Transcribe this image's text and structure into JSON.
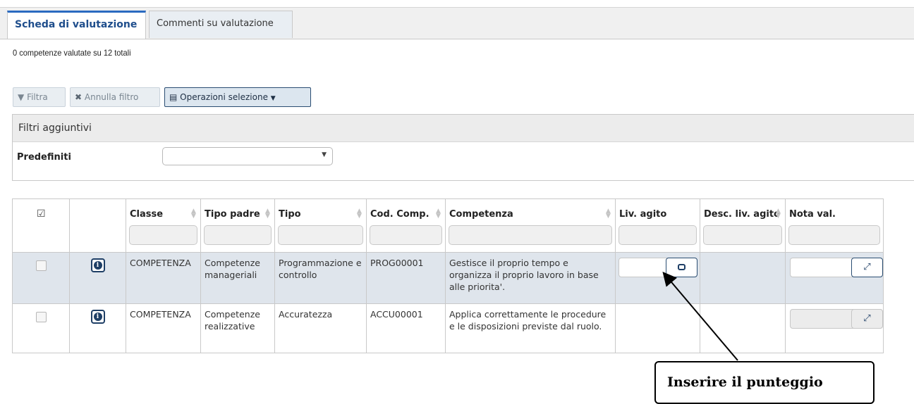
{
  "tabs": [
    {
      "label": "Scheda di valutazione",
      "active": true
    },
    {
      "label": "Commenti su valutazione",
      "active": false
    }
  ],
  "summary": "0 competenze valutate su 12 totali",
  "toolbar": {
    "filter_label": "Filtra",
    "clear_filter_label": "Annulla filtro",
    "operations_label": "Operazioni selezione"
  },
  "filters_panel": {
    "title": "Filtri aggiuntivi",
    "predefined_label": "Predefiniti",
    "predefined_value": ""
  },
  "table": {
    "columns": [
      "Classe",
      "Tipo padre",
      "Tipo",
      "Cod. Comp.",
      "Competenza",
      "Liv. agito",
      "Desc. liv. agito",
      "Nota val."
    ],
    "rows": [
      {
        "classe": "COMPETENZA",
        "tipo_padre": "Competenze manageriali",
        "tipo": "Programmazione e controllo",
        "cod_comp": "PROG00001",
        "competenza": "Gestisce il proprio tempo e organizza il proprio lavoro in base alle priorita'.",
        "liv_agito": "",
        "desc_liv_agito": "",
        "nota_val": ""
      },
      {
        "classe": "COMPETENZA",
        "tipo_padre": "Competenze realizzative",
        "tipo": "Accuratezza",
        "cod_comp": "ACCU00001",
        "competenza": "Applica correttamente le procedure e le disposizioni previste dal ruolo.",
        "liv_agito": "",
        "desc_liv_agito": "",
        "nota_val": ""
      }
    ]
  },
  "annotation": {
    "text": "Inserire il punteggio"
  },
  "icons": {
    "filter": "filter-icon",
    "clear": "x-icon",
    "operations": "clipboard-icon",
    "info": "info-icon",
    "calculator": "calculator-icon",
    "expand": "expand-icon"
  },
  "colors": {
    "accent": "#2a6ac0",
    "selected_row": "#dfe5ec",
    "button_border": "#2a4d72"
  }
}
